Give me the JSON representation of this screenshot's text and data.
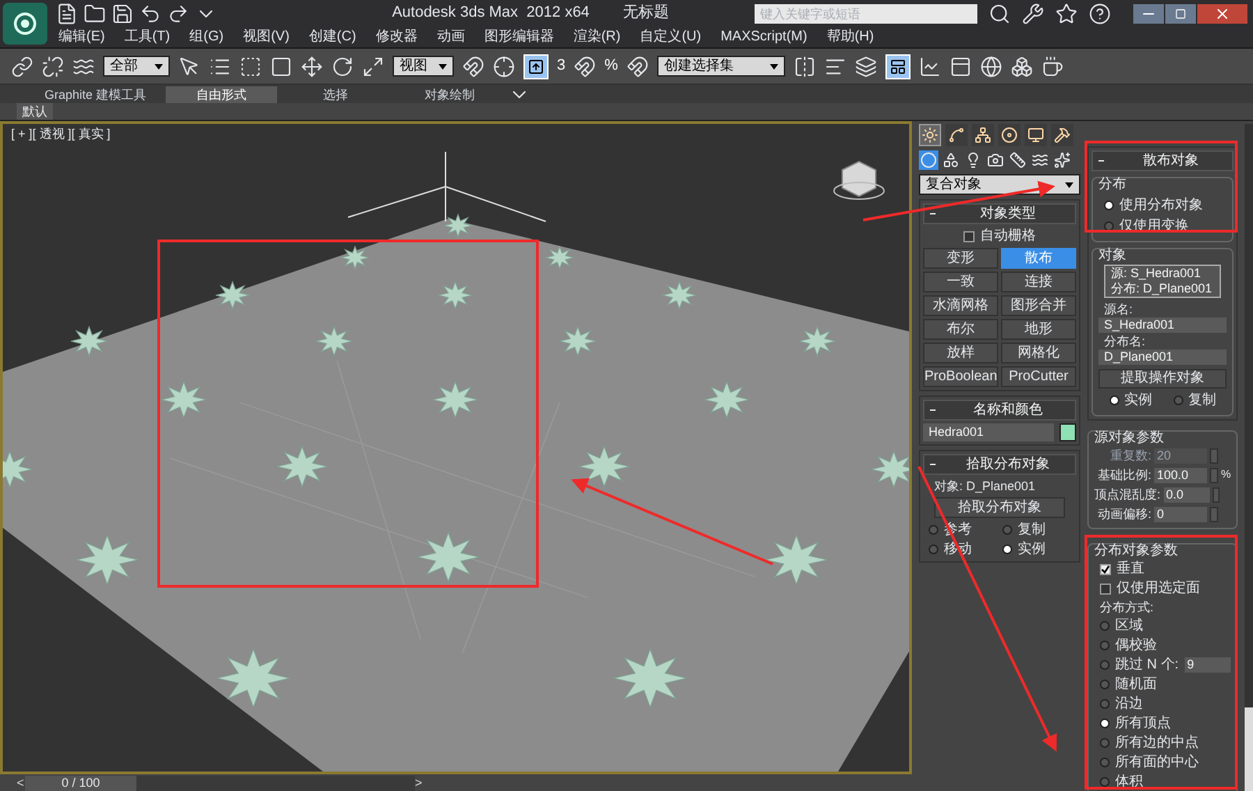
{
  "title_bar": {
    "app_title": "Autodesk 3ds Max  2012 x64",
    "document": "无标题",
    "search_placeholder": "键入关键字或短语"
  },
  "menu": [
    "编辑(E)",
    "工具(T)",
    "组(G)",
    "视图(V)",
    "创建(C)",
    "修改器",
    "动画",
    "图形编辑器",
    "渲染(R)",
    "自定义(U)",
    "MAXScript(M)",
    "帮助(H)"
  ],
  "toolbar": {
    "selection_filter": "全部",
    "coordinate_system": "视图",
    "snap_label": "3",
    "percent_label": "%",
    "named_selection": "创建选择集"
  },
  "ribbon_tabs": [
    {
      "label": "Graphite 建模工具",
      "selected": false
    },
    {
      "label": "自由形式",
      "selected": true
    },
    {
      "label": "选择",
      "selected": false
    },
    {
      "label": "对象绘制",
      "selected": false
    }
  ],
  "ribbon_panel": "默认",
  "viewport": {
    "label": "[ + ][ 透视 ][ 真实 ]"
  },
  "command_panel": {
    "tabs": [
      {
        "selected": true
      },
      {
        "selected": false
      },
      {
        "selected": false
      },
      {
        "selected": false
      },
      {
        "selected": false
      },
      {
        "selected": false
      }
    ],
    "sub_tabs": [
      {
        "selected": true
      },
      {
        "selected": false
      },
      {
        "selected": false
      },
      {
        "selected": false
      },
      {
        "selected": false
      },
      {
        "selected": false
      },
      {
        "selected": false
      }
    ],
    "category": "复合对象",
    "object_type": {
      "title": "对象类型",
      "autogrid": {
        "label": "自动栅格",
        "checked": false
      },
      "buttons": [
        {
          "label": "变形",
          "selected": false
        },
        {
          "label": "散布",
          "selected": true
        },
        {
          "label": "一致",
          "selected": false
        },
        {
          "label": "连接",
          "selected": false
        },
        {
          "label": "水滴网格",
          "selected": false
        },
        {
          "label": "图形合并",
          "selected": false
        },
        {
          "label": "布尔",
          "selected": false
        },
        {
          "label": "地形",
          "selected": false
        },
        {
          "label": "放样",
          "selected": false
        },
        {
          "label": "网格化",
          "selected": false
        },
        {
          "label": "ProBoolean",
          "selected": false
        },
        {
          "label": "ProCutter",
          "selected": false
        }
      ]
    },
    "name_color": {
      "title": "名称和颜色",
      "name": "Hedra001",
      "color": "#8fe0b4"
    },
    "pick_distribution": {
      "title": "拾取分布对象",
      "object_label": "对象: D_Plane001",
      "button": "拾取分布对象",
      "options": [
        {
          "label": "参考",
          "selected": false
        },
        {
          "label": "复制",
          "selected": false
        },
        {
          "label": "移动",
          "selected": false
        },
        {
          "label": "实例",
          "selected": true
        }
      ]
    },
    "scatter_objects": {
      "title": "散布对象",
      "distribution": {
        "title": "分布",
        "options": [
          {
            "label": "使用分布对象",
            "selected": true
          },
          {
            "label": "仅使用变换",
            "selected": false
          }
        ]
      },
      "objects": {
        "title": "对象",
        "list": [
          "源: S_Hedra001",
          "分布: D_Plane001"
        ],
        "source_label": "源名:",
        "source_name": "S_Hedra001",
        "dist_label": "分布名:",
        "dist_name": "D_Plane001",
        "button": "提取操作对象",
        "options": [
          {
            "label": "实例",
            "selected": true
          },
          {
            "label": "复制",
            "selected": false
          }
        ]
      }
    },
    "source_params": {
      "title": "源对象参数",
      "fields": [
        {
          "label": "重复数:",
          "value": "20",
          "disabled": true
        },
        {
          "label": "基础比例:",
          "value": "100.0",
          "disabled": false,
          "unit": "%"
        },
        {
          "label": "顶点混乱度:",
          "value": "0.0",
          "disabled": false
        },
        {
          "label": "动画偏移:",
          "value": "0",
          "disabled": false
        }
      ]
    },
    "dist_params": {
      "title": "分布对象参数",
      "checks": [
        {
          "label": "垂直",
          "checked": true
        },
        {
          "label": "仅使用选定面",
          "checked": false
        }
      ],
      "method_label": "分布方式:",
      "methods": [
        {
          "label": "区域",
          "selected": false
        },
        {
          "label": "偶校验",
          "selected": false
        },
        {
          "label": "跳过 N 个:",
          "selected": false,
          "value": "9"
        },
        {
          "label": "随机面",
          "selected": false
        },
        {
          "label": "沿边",
          "selected": false
        },
        {
          "label": "所有顶点",
          "selected": true
        },
        {
          "label": "所有边的中点",
          "selected": false
        },
        {
          "label": "所有面的中心",
          "selected": false
        },
        {
          "label": "体积",
          "selected": false
        }
      ]
    }
  },
  "timeline": {
    "prev": "<",
    "position": "0 / 100",
    "next": ">",
    "level": 0
  }
}
